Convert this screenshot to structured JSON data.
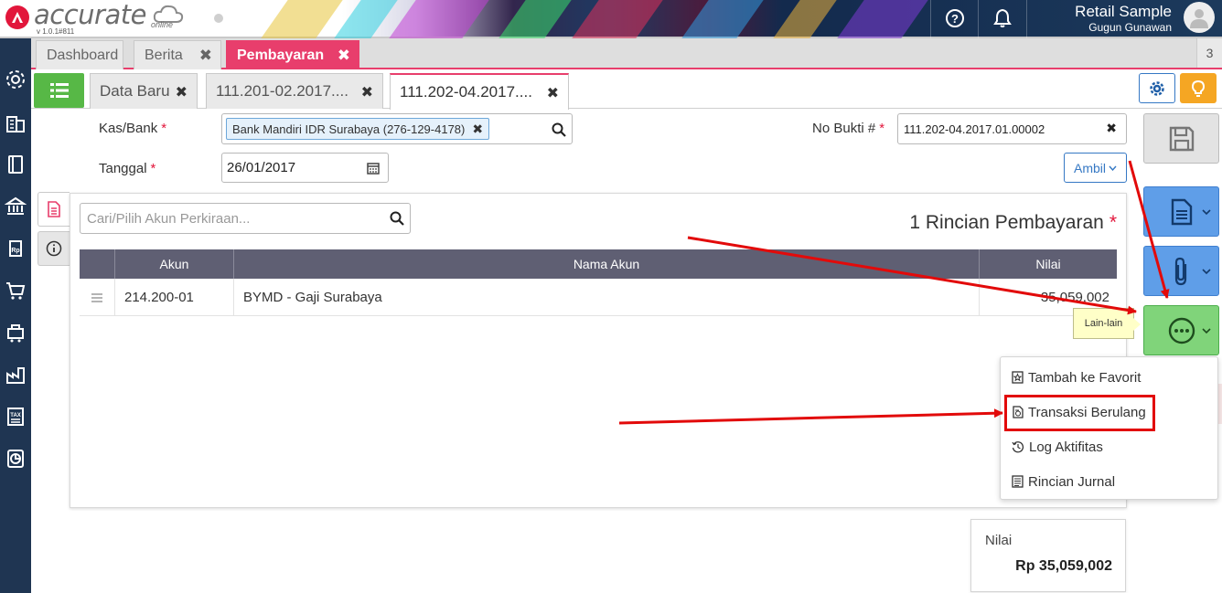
{
  "app": {
    "logo_text": "accurate",
    "logo_suffix": "online",
    "version": "v 1.0.1#811",
    "company": "Retail Sample",
    "user": "Gugun Gunawan"
  },
  "module_tabs": [
    {
      "label": "Dashboard",
      "active": false,
      "closable": false
    },
    {
      "label": "Berita",
      "active": false,
      "closable": true
    },
    {
      "label": "Pembayaran",
      "active": true,
      "closable": true
    }
  ],
  "module_tab_count": "3",
  "doc_tabs": [
    {
      "label": "Data Baru",
      "active": false
    },
    {
      "label": "111.201-02.2017....",
      "active": false
    },
    {
      "label": "111.202-04.2017....",
      "active": true
    }
  ],
  "form": {
    "kas_bank_label": "Kas/Bank",
    "kas_bank_value": "Bank Mandiri IDR Surabaya (276-129-4178)",
    "tanggal_label": "Tanggal",
    "tanggal_value": "26/01/2017",
    "no_bukti_label": "No Bukti #",
    "no_bukti_value": "111.202-04.2017.01.00002",
    "required_mark": "*",
    "ambil_label": "Ambil"
  },
  "detail": {
    "search_placeholder": "Cari/Pilih Akun Perkiraan...",
    "title": "1 Rincian Pembayaran",
    "columns": [
      "Akun",
      "Nama Akun",
      "Nilai"
    ],
    "rows": [
      {
        "akun": "214.200-01",
        "nama": "BYMD - Gaji Surabaya",
        "nilai": "35,059,002"
      }
    ]
  },
  "actions": {
    "tooltip": "Lain-lain",
    "menu": [
      {
        "label": "Tambah ke Favorit",
        "icon": "favorite-icon"
      },
      {
        "label": "Transaksi Berulang",
        "icon": "recurring-icon",
        "highlighted": true
      },
      {
        "label": "Log Aktifitas",
        "icon": "history-icon"
      },
      {
        "label": "Rincian Jurnal",
        "icon": "journal-icon"
      }
    ]
  },
  "total": {
    "label": "Nilai",
    "value": "Rp 35,059,002"
  },
  "colors": {
    "accent_pink": "#e83e6c",
    "sidebar_navy": "#1f3552",
    "annotation_red": "#e20a0a",
    "action_blue": "#5f9ee8",
    "action_green": "#80d47a"
  }
}
